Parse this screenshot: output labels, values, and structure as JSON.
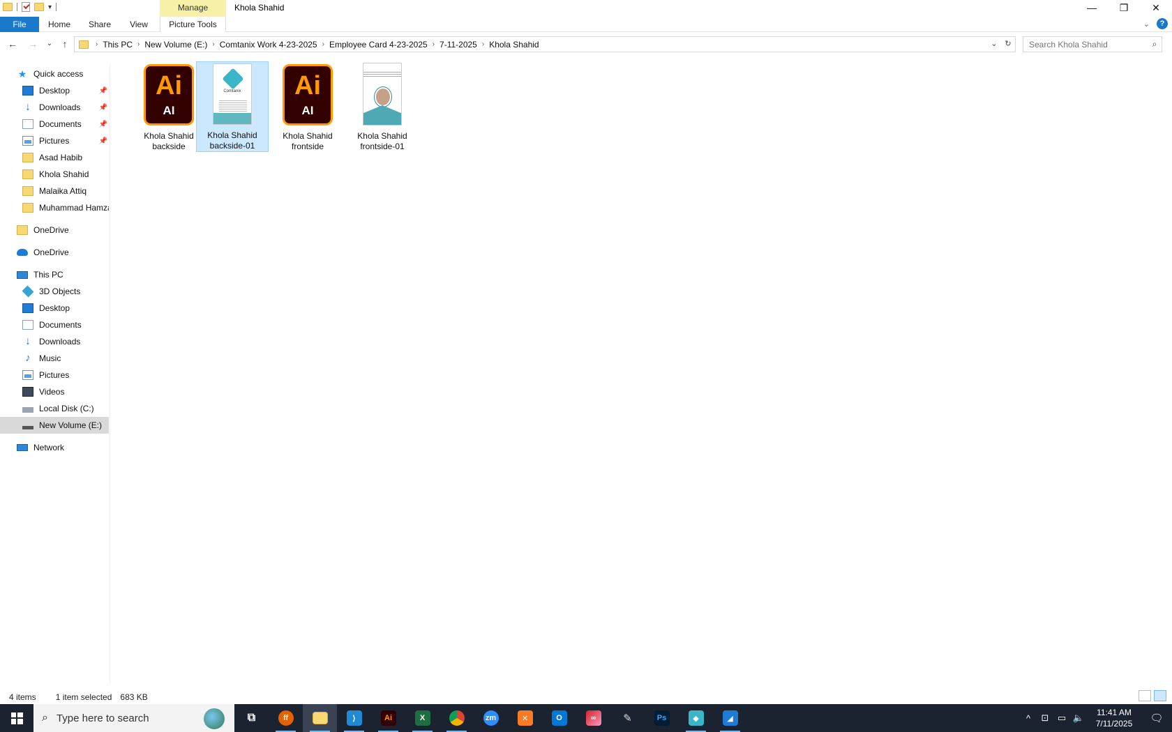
{
  "window": {
    "title": "Khola Shahid",
    "contextual_group": "Manage",
    "controls": {
      "minimize": "—",
      "restore": "❐",
      "close": "✕"
    }
  },
  "ribbon": {
    "tabs": [
      "File",
      "Home",
      "Share",
      "View",
      "Picture Tools"
    ],
    "help": "?"
  },
  "nav": {
    "back": "←",
    "forward": "→",
    "recent": "⌄",
    "up": "↑",
    "breadcrumbs": [
      "This PC",
      "New Volume (E:)",
      "Comtanix Work 4-23-2025",
      "Employee Card 4-23-2025",
      "7-11-2025",
      "Khola Shahid"
    ],
    "search_placeholder": "Search Khola Shahid"
  },
  "sidebar": {
    "items": [
      {
        "label": "Quick access",
        "icon": "star-icon",
        "pinned": false
      },
      {
        "label": "Desktop",
        "icon": "desktop-icon",
        "pinned": true
      },
      {
        "label": "Downloads",
        "icon": "download-icon",
        "pinned": true
      },
      {
        "label": "Documents",
        "icon": "documents-icon",
        "pinned": true
      },
      {
        "label": "Pictures",
        "icon": "pictures-icon",
        "pinned": true
      },
      {
        "label": "Asad Habib",
        "icon": "folder-icon",
        "pinned": false
      },
      {
        "label": "Khola Shahid",
        "icon": "folder-icon",
        "pinned": false
      },
      {
        "label": "Malaika Attiq",
        "icon": "folder-icon",
        "pinned": false
      },
      {
        "label": "Muhammad Hamza",
        "icon": "folder-icon",
        "pinned": false
      },
      {
        "label": "OneDrive",
        "icon": "folder-icon",
        "pinned": false
      },
      {
        "label": "OneDrive",
        "icon": "cloud-icon",
        "pinned": false
      },
      {
        "label": "This PC",
        "icon": "computer-icon",
        "pinned": false
      },
      {
        "label": "3D Objects",
        "icon": "cube-icon",
        "pinned": false
      },
      {
        "label": "Desktop",
        "icon": "desktop-icon",
        "pinned": false
      },
      {
        "label": "Documents",
        "icon": "documents-icon",
        "pinned": false
      },
      {
        "label": "Downloads",
        "icon": "download-icon",
        "pinned": false
      },
      {
        "label": "Music",
        "icon": "music-icon",
        "pinned": false
      },
      {
        "label": "Pictures",
        "icon": "pictures-icon",
        "pinned": false
      },
      {
        "label": "Videos",
        "icon": "video-icon",
        "pinned": false
      },
      {
        "label": "Local Disk (C:)",
        "icon": "drive-icon",
        "pinned": false
      },
      {
        "label": "New Volume (E:)",
        "icon": "drive-icon",
        "pinned": false,
        "selected": true
      },
      {
        "label": "Network",
        "icon": "network-icon",
        "pinned": false
      }
    ]
  },
  "files": [
    {
      "line1": "Khola Shahid",
      "line2": "backside",
      "type": "ai-file-icon",
      "selected": false,
      "icon_text": "Ai",
      "icon_sub": "AI"
    },
    {
      "line1": "Khola Shahid",
      "line2": "backside-01",
      "type": "image-thumbnail",
      "selected": true,
      "thumb_brand": "Comtanix"
    },
    {
      "line1": "Khola Shahid",
      "line2": "frontside",
      "type": "ai-file-icon",
      "selected": false,
      "icon_text": "Ai",
      "icon_sub": "AI"
    },
    {
      "line1": "Khola Shahid",
      "line2": "frontside-01",
      "type": "image-thumbnail",
      "selected": false
    }
  ],
  "status": {
    "item_count": "4 items",
    "selection": "1 item selected",
    "size": "683 KB"
  },
  "taskbar": {
    "search_placeholder": "Type here to search",
    "apps": [
      {
        "name": "task-view-icon",
        "label": "⧉",
        "color": "#1c2330"
      },
      {
        "name": "firefox-icon",
        "label": "ff",
        "color": "#e66000"
      },
      {
        "name": "file-explorer-icon",
        "label": "",
        "color": "#f8d775"
      },
      {
        "name": "vscode-icon",
        "label": "⟩",
        "color": "#1f8ad2"
      },
      {
        "name": "illustrator-icon",
        "label": "Ai",
        "color": "#330000"
      },
      {
        "name": "excel-icon",
        "label": "X",
        "color": "#1d6f42"
      },
      {
        "name": "chrome-icon",
        "label": "◉",
        "color": "#db4437"
      },
      {
        "name": "zoom-icon",
        "label": "zm",
        "color": "#2d8cff"
      },
      {
        "name": "xampp-icon",
        "label": "✕",
        "color": "#fb7a24"
      },
      {
        "name": "outlook-icon",
        "label": "O",
        "color": "#0078d4"
      },
      {
        "name": "creative-cloud-icon",
        "label": "∞",
        "color": "#da1f26"
      },
      {
        "name": "pen-tool-icon",
        "label": "✎",
        "color": "#1c2330"
      },
      {
        "name": "photoshop-icon",
        "label": "Ps",
        "color": "#001e36"
      },
      {
        "name": "comtanix-app-icon",
        "label": "◆",
        "color": "#3bb5c8"
      },
      {
        "name": "paint-app-icon",
        "label": "◢",
        "color": "#1e7bd6"
      }
    ],
    "tray": {
      "chevron": "^",
      "time": "11:41 AM",
      "date": "7/11/2025"
    }
  }
}
